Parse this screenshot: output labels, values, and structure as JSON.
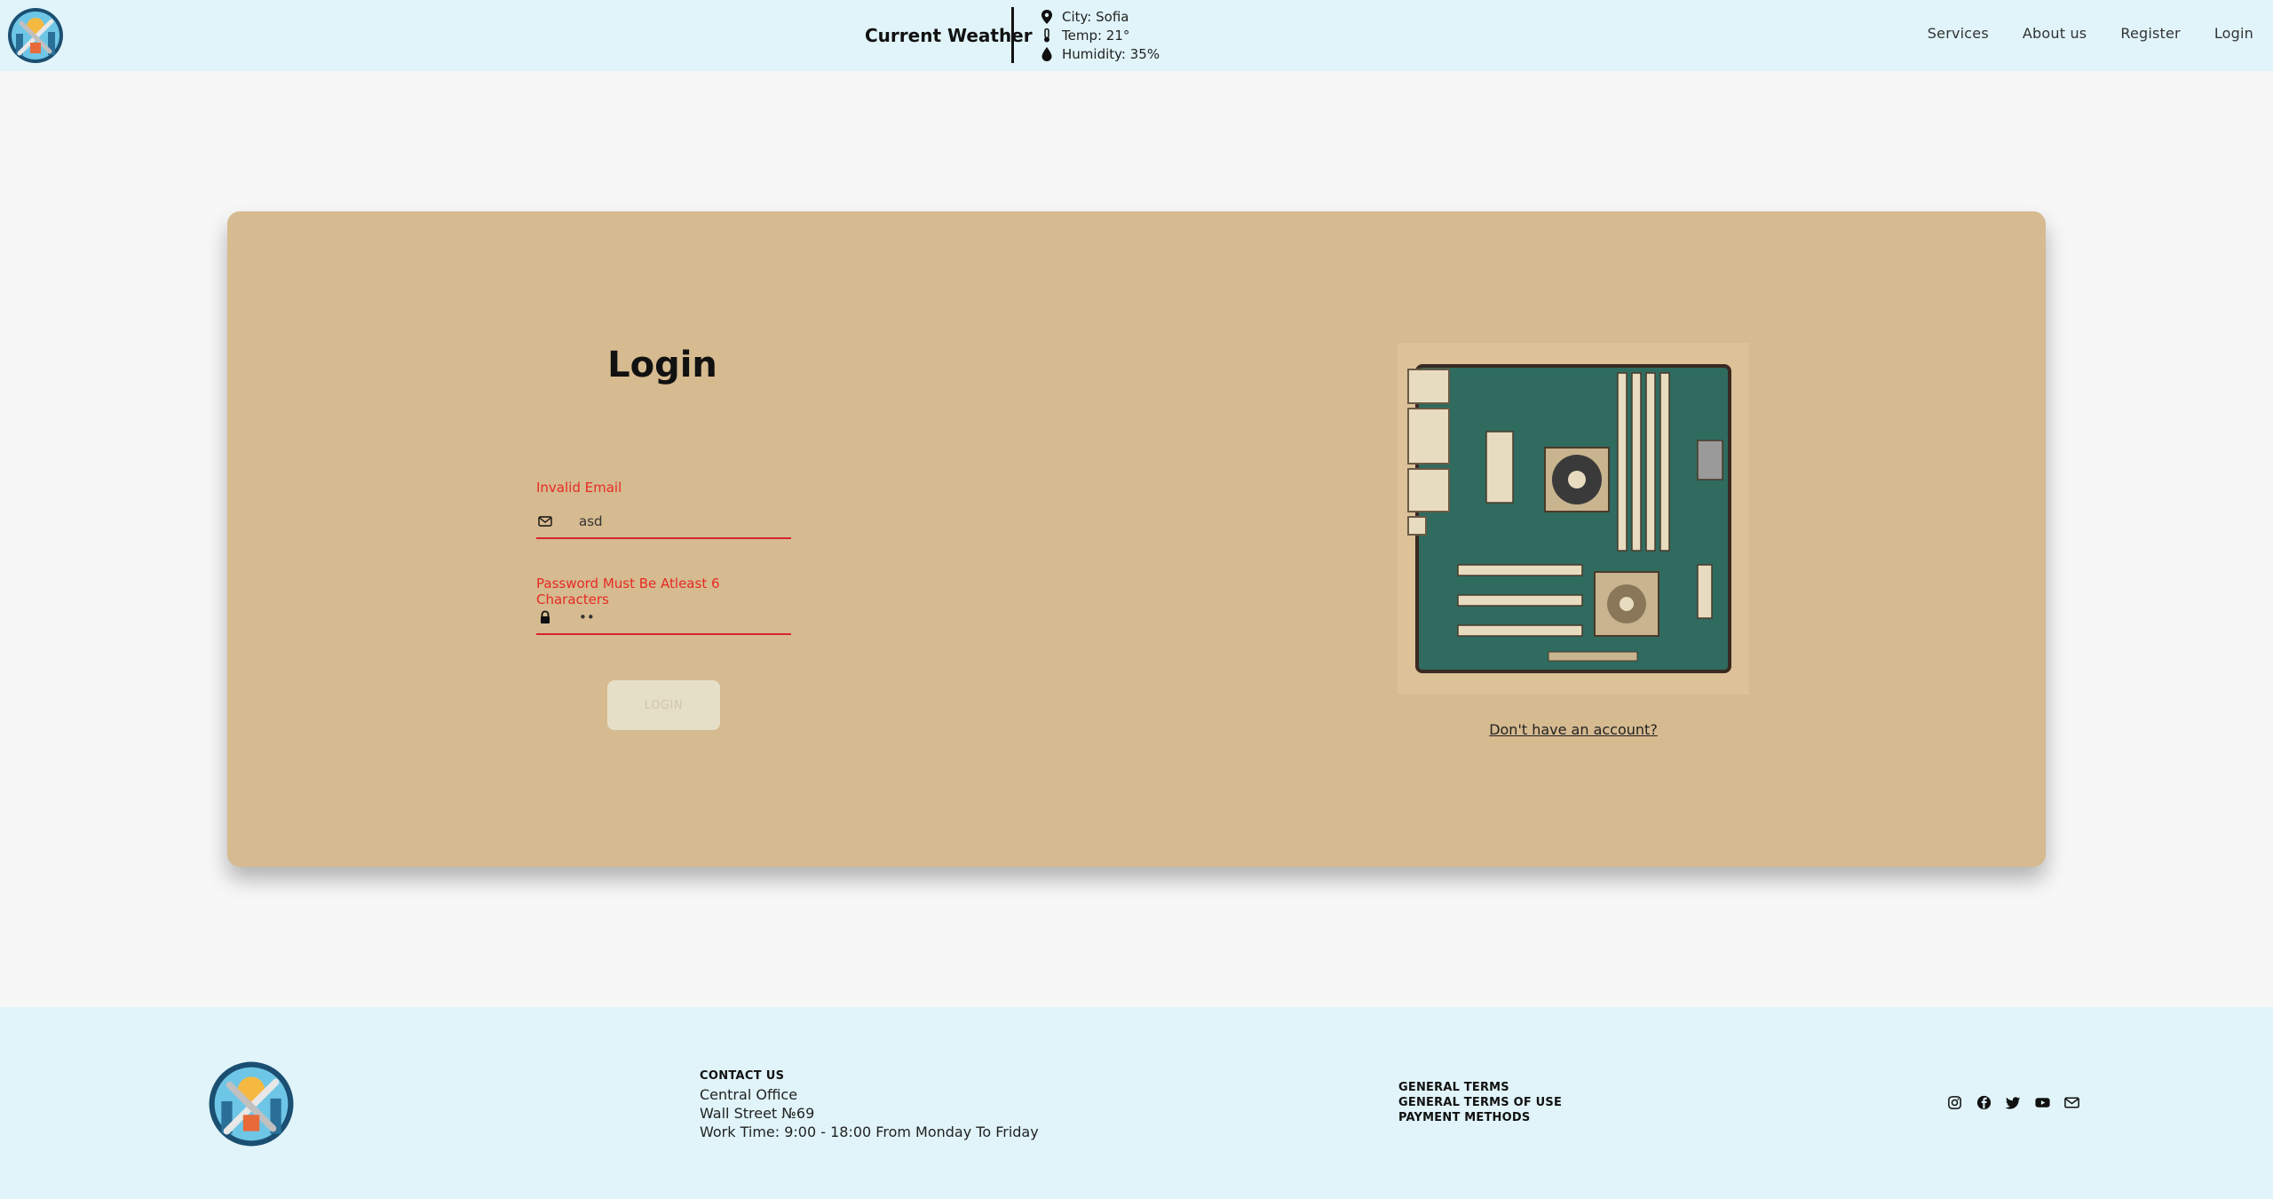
{
  "header": {
    "logo_alt": "logo-icon",
    "weather_title": "Current Weather",
    "weather": {
      "city": "City: Sofia",
      "temp": "Temp: 21°",
      "humidity": "Humidity: 35%"
    },
    "nav": [
      "Services",
      "About us",
      "Register",
      "Login"
    ]
  },
  "login": {
    "title": "Login",
    "email": {
      "error": "Invalid Email",
      "value": "asd",
      "icon": "envelope-icon"
    },
    "password": {
      "error": "Password Must Be Atleast 6 Characters",
      "value": "••",
      "icon": "lock-icon"
    },
    "button_label": "LOGIN",
    "no_account_link": "Don't have an account?"
  },
  "footer": {
    "contact_heading": "CONTACT US",
    "contact_lines": [
      "Central Office",
      "Wall Street №69",
      "Work Time: 9:00 - 18:00 From Monday To Friday"
    ],
    "terms": [
      "GENERAL TERMS",
      "GENERAL TERMS OF USE",
      "PAYMENT METHODS"
    ],
    "socials": [
      "instagram-icon",
      "facebook-icon",
      "twitter-icon",
      "youtube-icon",
      "envelope-icon"
    ]
  },
  "colors": {
    "header_bg": "#e0f4f9",
    "card_bg": "#d6ba90",
    "error": "#e52b23",
    "page_bg": "#f7f7f7"
  }
}
